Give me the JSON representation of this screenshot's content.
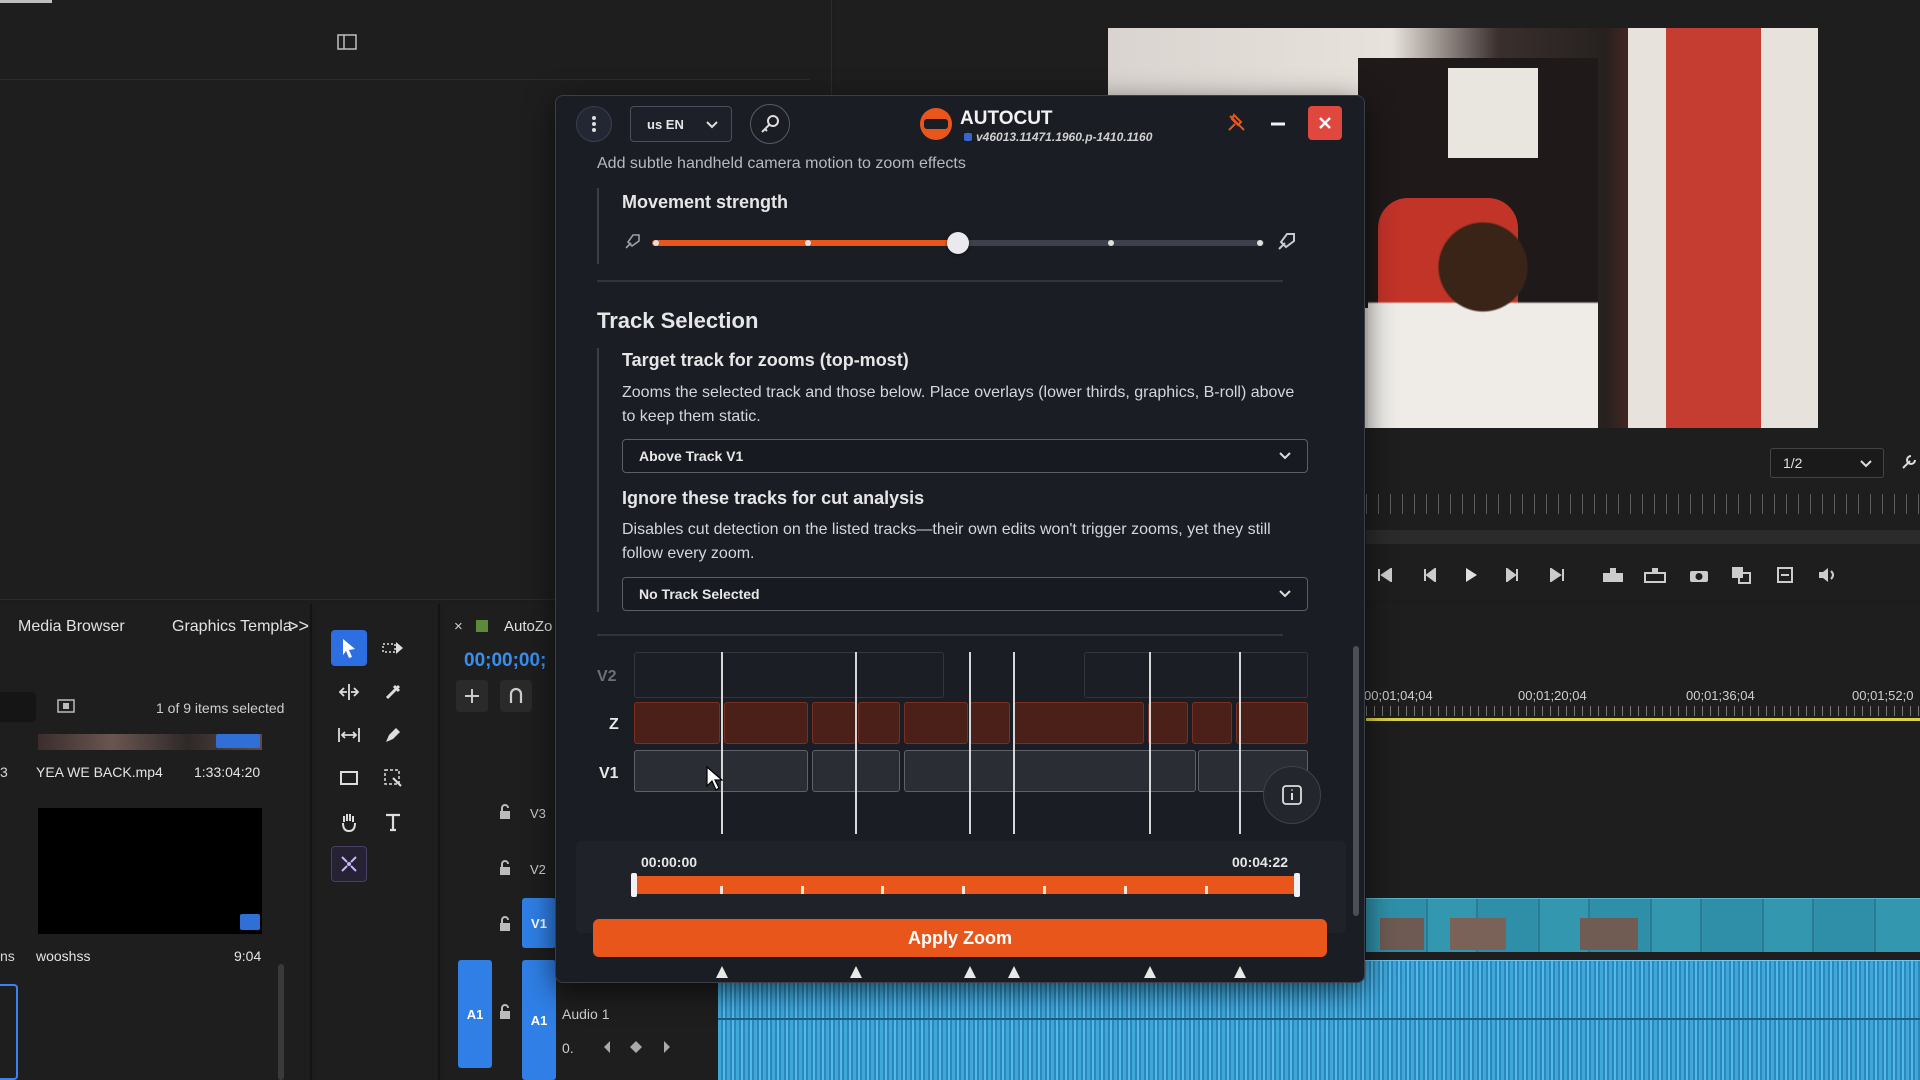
{
  "premiere": {
    "panel_tabs": {
      "media_browser": "Media Browser",
      "graphics_templates": "Graphics Templa",
      "overflow": ">>"
    },
    "project": {
      "selection_info": "1 of 9 items selected",
      "row_number": "3",
      "clip1": {
        "name": "YEA WE BACK.mp4",
        "duration": "1:33:04:20"
      },
      "clip2": {
        "name": "wooshss",
        "duration": "9:04"
      },
      "side_label": "ns"
    },
    "timeline": {
      "tab_name": "AutoZo",
      "close": "×",
      "timecode": "00;00;00;",
      "ruler": [
        "00;01;04;04",
        "00;01;20;04",
        "00;01;36;04",
        "00;01;52;0"
      ],
      "tracks": {
        "v3": "V3",
        "v2": "V2",
        "v1": "V1",
        "a1": "A1",
        "a1_source": "A1",
        "audio_name": "Audio 1",
        "zero": "0."
      }
    },
    "program": {
      "resolution": "1/2"
    }
  },
  "autocut": {
    "menu_icon": "vertical-dots",
    "language": "us EN",
    "app_name": "AUTOCUT",
    "version": "v46013.11471.1960.p-1410.1160",
    "desc_top": "Add subtle handheld camera motion to zoom effects",
    "movement_strength": {
      "label": "Movement strength",
      "value": 0.5,
      "steps": 4
    },
    "track_selection": {
      "title": "Track Selection",
      "target": {
        "label": "Target track for zooms (top-most)",
        "desc": "Zooms the selected track and those below. Place overlays (lower thirds, graphics, B-roll) above to keep them static.",
        "value": "Above Track V1"
      },
      "ignore": {
        "label": "Ignore these tracks for cut analysis",
        "desc": "Disables cut detection on the listed tracks—their own edits won't trigger zooms, yet they still follow every zoom.",
        "value": "No Track Selected"
      }
    },
    "preview": {
      "tracks": {
        "v2": "V2",
        "z": "Z",
        "v1": "V1"
      },
      "start_time": "00:00:00",
      "end_time": "00:04:22"
    },
    "apply_label": "Apply Zoom",
    "colors": {
      "accent": "#e8561b",
      "close": "#e0473f"
    }
  }
}
